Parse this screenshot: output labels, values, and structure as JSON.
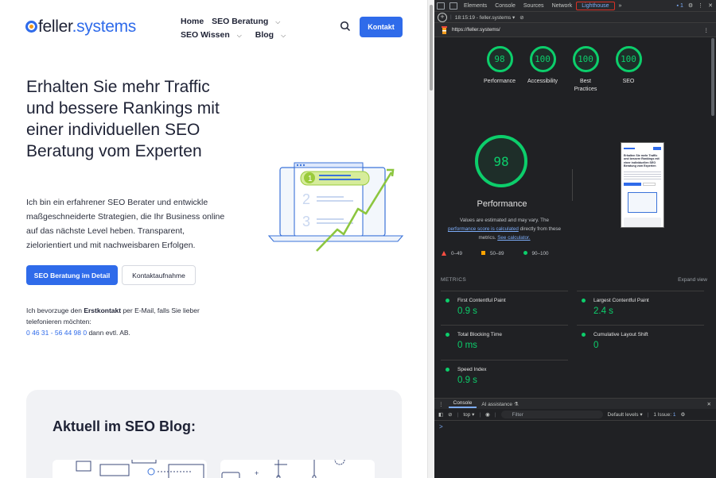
{
  "site": {
    "logo_main": "feller",
    "logo_suffix": ".systems",
    "nav": [
      "Home",
      "SEO Beratung",
      "SEO Wissen",
      "Blog"
    ],
    "contact_button": "Kontakt",
    "hero_title": "Erhalten Sie mehr Traffic und bessere Rankings mit einer individuellen SEO Beratung vom Experten",
    "hero_text": "Ich bin ein erfahrener SEO Berater und entwickle maßgeschneiderte Strategien, die Ihr Business online auf das nächste Level heben. Transparent, zielorientiert und mit nachweisbaren Erfolgen.",
    "primary_button": "SEO Beratung im Detail",
    "secondary_button": "Kontaktaufnahme",
    "contact_pre": "Ich bevorzuge den ",
    "contact_bold": "Erstkontakt",
    "contact_post": " per E-Mail, falls Sie lieber telefonieren möchten:",
    "phone": "0 46 31 - 56 44 98 0",
    "phone_suffix": " dann evtl. AB.",
    "blog_heading": "Aktuell im SEO Blog:",
    "illustration_numbers": [
      "2",
      "3"
    ],
    "thumb_headline": "Erhalten Sie mehr Traffic und bessere Rankings mit einer individuellen SEO Beratung vom Experten"
  },
  "devtools": {
    "tabs": [
      "Elements",
      "Console",
      "Sources",
      "Network",
      "Lighthouse"
    ],
    "active_tab": "Lighthouse",
    "issues_count": "1",
    "report_time": "18:15:19 - feller.systems",
    "url": "https://feller.systems/",
    "categories": [
      {
        "score": "98",
        "label": "Performance"
      },
      {
        "score": "100",
        "label": "Accessibility"
      },
      {
        "score": "100",
        "label": "Best Practices"
      },
      {
        "score": "100",
        "label": "SEO"
      }
    ],
    "performance_score": "98",
    "performance_label": "Performance",
    "note_1": "Values are estimated and may vary. The",
    "note_link_1": "performance score is calculated",
    "note_2": " directly from these metrics. ",
    "note_link_2": "See calculator.",
    "legend": [
      "0–49",
      "50–89",
      "90–100"
    ],
    "metrics_title": "METRICS",
    "expand_label": "Expand view",
    "metrics": [
      {
        "name": "First Contentful Paint",
        "value": "0.9 s"
      },
      {
        "name": "Largest Contentful Paint",
        "value": "2.4 s"
      },
      {
        "name": "Total Blocking Time",
        "value": "0 ms"
      },
      {
        "name": "Cumulative Layout Shift",
        "value": "0"
      },
      {
        "name": "Speed Index",
        "value": "0.9 s"
      }
    ],
    "drawer_tabs": [
      "Console",
      "AI assistance"
    ],
    "context": "top",
    "filter_placeholder": "Filter",
    "levels": "Default levels",
    "issues_label": "1 Issue:",
    "prompt": ">"
  },
  "colors": {
    "brand_blue": "#2f6bea",
    "lh_green": "#0cce6b",
    "lh_red": "#ff4e42",
    "lh_orange": "#ffa400",
    "devtools_bg": "#202124"
  }
}
